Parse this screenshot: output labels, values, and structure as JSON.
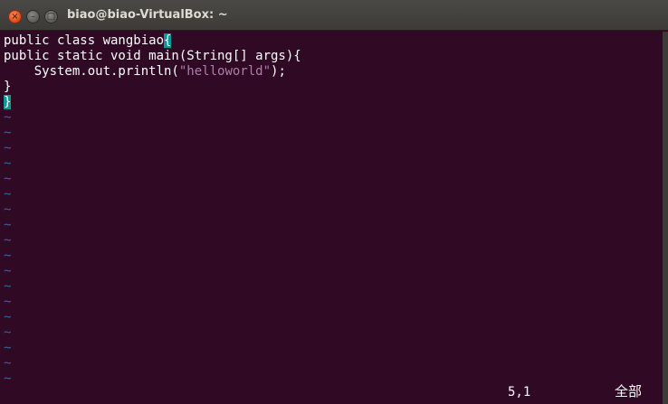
{
  "window": {
    "title": "biao@biao-VirtualBox: ~",
    "buttons": {
      "close_glyph": "×",
      "minimize_glyph": "–",
      "maximize_glyph": "□"
    }
  },
  "editor": {
    "lines": [
      {
        "pre": "public class wangbiao",
        "cursor": "{",
        "str": "",
        "post": ""
      },
      {
        "pre": "public static void main(String[] args){",
        "cursor": "",
        "str": "",
        "post": ""
      },
      {
        "pre": "    System.out.println(",
        "cursor": "",
        "str": "\"helloworld\"",
        "post": ");"
      },
      {
        "pre": "}",
        "cursor": "",
        "str": "",
        "post": ""
      },
      {
        "pre": "",
        "cursor": "}",
        "str": "",
        "post": ""
      }
    ],
    "tilde": "~",
    "tilde_count": 18
  },
  "status": {
    "position": "5,1",
    "scroll": "全部"
  },
  "colors": {
    "background": "#300a24",
    "text": "#ffffff",
    "string": "#ad7fa8",
    "tilde": "#3465a4",
    "cursor_highlight": "#06989a"
  }
}
